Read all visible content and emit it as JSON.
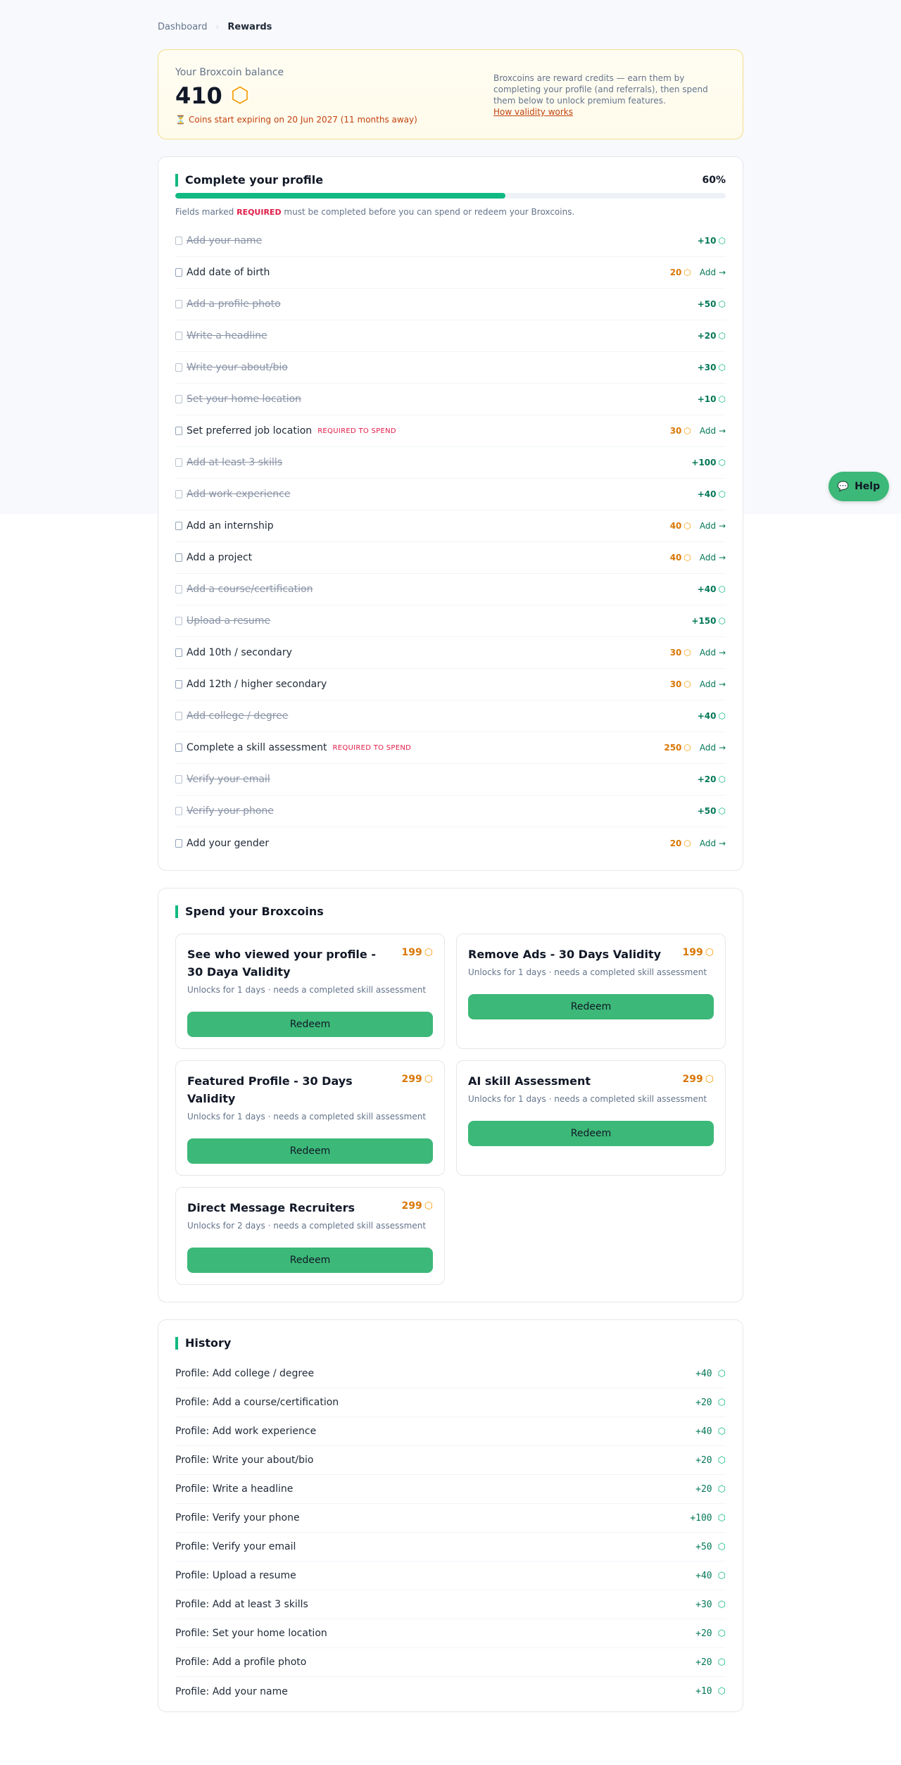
{
  "breadcrumb": {
    "parent": "Dashboard",
    "separator": "›",
    "current": "Rewards"
  },
  "balance": {
    "label": "Your Broxcoin balance",
    "amount": "410",
    "coin_glyph": "⬡",
    "expiry_icon": "⏳",
    "expiry": "Coins start expiring on 20 Jun 2027 (11 months away)",
    "info": "Broxcoins are reward credits — earn them by completing your profile (and referrals), then spend them below to unlock premium features.",
    "link": "How validity works"
  },
  "profile": {
    "title": "Complete your profile",
    "percent_label": "60%",
    "percent_value": 60,
    "note_prefix": "Fields marked",
    "note_required": "REQUIRED",
    "note_suffix": "must be completed before you can spend or redeem your Broxcoins.",
    "add_label": "Add →",
    "tasks": [
      {
        "label": "Add your name",
        "done": true,
        "points": "+10"
      },
      {
        "label": "Add date of birth",
        "done": false,
        "points": "20"
      },
      {
        "label": "Add a profile photo",
        "done": true,
        "points": "+50"
      },
      {
        "label": "Write a headline",
        "done": true,
        "points": "+20"
      },
      {
        "label": "Write your about/bio",
        "done": true,
        "points": "+30"
      },
      {
        "label": "Set your home location",
        "done": true,
        "points": "+10"
      },
      {
        "label": "Set preferred job location",
        "done": false,
        "points": "30",
        "required": "REQUIRED TO SPEND"
      },
      {
        "label": "Add at least 3 skills",
        "done": true,
        "points": "+100"
      },
      {
        "label": "Add work experience",
        "done": true,
        "points": "+40"
      },
      {
        "label": "Add an internship",
        "done": false,
        "points": "40"
      },
      {
        "label": "Add a project",
        "done": false,
        "points": "40"
      },
      {
        "label": "Add a course/certification",
        "done": true,
        "points": "+40"
      },
      {
        "label": "Upload a resume",
        "done": true,
        "points": "+150"
      },
      {
        "label": "Add 10th / secondary",
        "done": false,
        "points": "30"
      },
      {
        "label": "Add 12th / higher secondary",
        "done": false,
        "points": "30"
      },
      {
        "label": "Add college / degree",
        "done": true,
        "points": "+40"
      },
      {
        "label": "Complete a skill assessment",
        "done": false,
        "points": "250",
        "required": "REQUIRED TO SPEND"
      },
      {
        "label": "Verify your email",
        "done": true,
        "points": "+20"
      },
      {
        "label": "Verify your phone",
        "done": true,
        "points": "+50"
      },
      {
        "label": "Add your gender",
        "done": false,
        "points": "20"
      }
    ]
  },
  "spend": {
    "title": "Spend your Broxcoins",
    "redeem_label": "Redeem",
    "rewards": [
      {
        "title": "See who viewed your profile - 30 Daya Validity",
        "price": "199",
        "subtitle": "Unlocks for 1 days · needs a completed skill assessment"
      },
      {
        "title": "Remove Ads - 30 Days Validity",
        "price": "199",
        "subtitle": "Unlocks for 1 days · needs a completed skill assessment"
      },
      {
        "title": "Featured Profile - 30 Days Validity",
        "price": "299",
        "subtitle": "Unlocks for 1 days · needs a completed skill assessment"
      },
      {
        "title": "AI skill Assessment",
        "price": "299",
        "subtitle": "Unlocks for 1 days · needs a completed skill assessment"
      },
      {
        "title": "Direct Message Recruiters",
        "price": "299",
        "subtitle": "Unlocks for 2 days · needs a completed skill assessment"
      }
    ]
  },
  "history": {
    "title": "History",
    "items": [
      {
        "label": "Profile: Add college / degree",
        "amount": "+40"
      },
      {
        "label": "Profile: Add a course/certification",
        "amount": "+20"
      },
      {
        "label": "Profile: Add work experience",
        "amount": "+40"
      },
      {
        "label": "Profile: Write your about/bio",
        "amount": "+20"
      },
      {
        "label": "Profile: Write a headline",
        "amount": "+20"
      },
      {
        "label": "Profile: Verify your phone",
        "amount": "+100"
      },
      {
        "label": "Profile: Verify your email",
        "amount": "+50"
      },
      {
        "label": "Profile: Upload a resume",
        "amount": "+40"
      },
      {
        "label": "Profile: Add at least 3 skills",
        "amount": "+30"
      },
      {
        "label": "Profile: Set your home location",
        "amount": "+20"
      },
      {
        "label": "Profile: Add a profile photo",
        "amount": "+20"
      },
      {
        "label": "Profile: Add your name",
        "amount": "+10"
      }
    ]
  },
  "help": {
    "icon": "💬",
    "label": "Help"
  },
  "colors": {
    "accent": "#10b981",
    "button": "#3cb878",
    "coin": "#f59e0b",
    "required": "#e11d48",
    "expiry": "#c2410c"
  },
  "icons": {
    "coin": "coin-icon",
    "checkbox": "checkbox-icon",
    "hourglass": "hourglass-icon",
    "chat": "chat-icon"
  }
}
